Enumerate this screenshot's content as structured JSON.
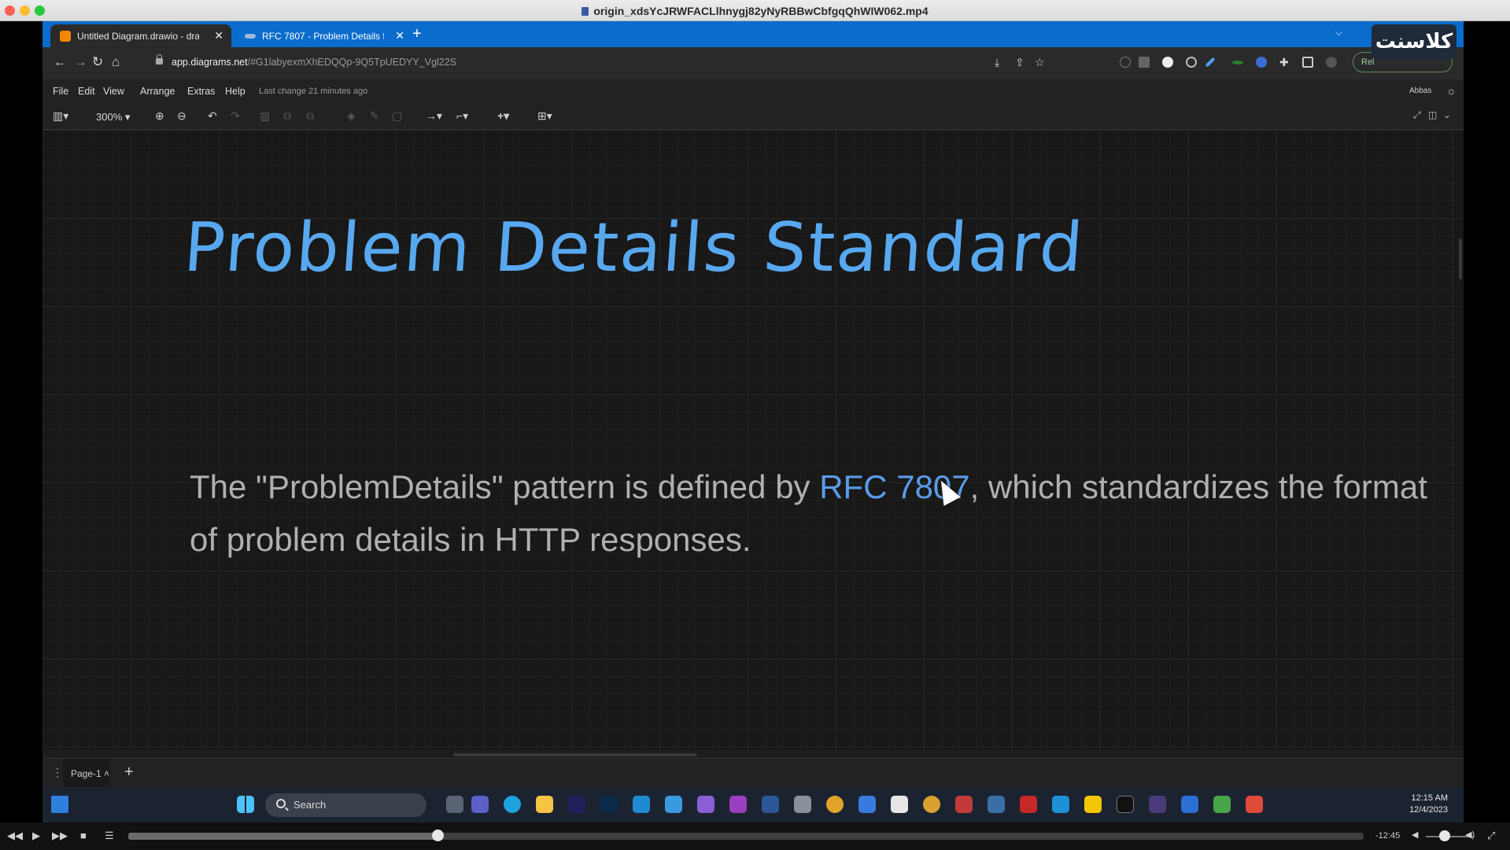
{
  "window": {
    "title": "origin_xdsYcJRWFACLlhnygj82yNyRBBwCbfgqQhWIW062.mp4"
  },
  "browser": {
    "tabs": [
      {
        "label": "Untitled Diagram.drawio - draw...",
        "active": true
      },
      {
        "label": "RFC 7807 - Problem Details for HTTP APIs",
        "active": false
      }
    ],
    "new_tab": "+",
    "url_host": "app.diagrams.net",
    "url_rest": "/#G1labyexmXhEDQQp-9Q5TpUEDYY_Vgl22S",
    "relaunch_label": "Rel",
    "watermark_text": "كلاسنت"
  },
  "drawio": {
    "menu": [
      "File",
      "Edit",
      "View",
      "Arrange",
      "Extras",
      "Help"
    ],
    "last_change": "Last change 21 minutes ago",
    "user": "Abbas",
    "zoom": "300%",
    "page_tab": "Page-1",
    "diagram": {
      "title": "Problem Details Standard",
      "text_before": "The \"ProblemDetails\" pattern is defined by ",
      "text_link": "RFC 7807",
      "text_after": ", which standardizes the format of problem details in HTTP responses."
    },
    "title_color": "#58a8f0",
    "link_color": "#5b9be8"
  },
  "taskbar": {
    "search_placeholder": "Search",
    "time": "12:15 AM",
    "date": "12/4/2023"
  },
  "player": {
    "remaining": "-12:45",
    "progress": 0.25
  }
}
